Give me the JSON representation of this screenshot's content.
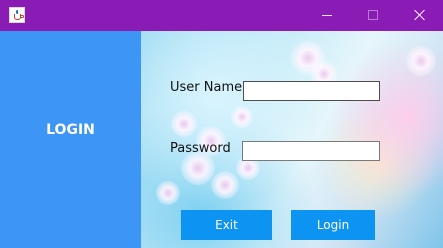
{
  "window": {
    "app_icon": "java-cup-icon",
    "controls": {
      "minimize": "minimize-icon",
      "maximize": "maximize-icon",
      "close": "close-icon"
    }
  },
  "side": {
    "title": "LOGIN"
  },
  "form": {
    "username_label": "User Name",
    "username_value": "",
    "password_label": "Password",
    "password_value": ""
  },
  "buttons": {
    "exit": "Exit",
    "login": "Login"
  },
  "colors": {
    "titlebar": "#8a1bb4",
    "side_panel": "#3d96f6",
    "button": "#0d93f2"
  }
}
